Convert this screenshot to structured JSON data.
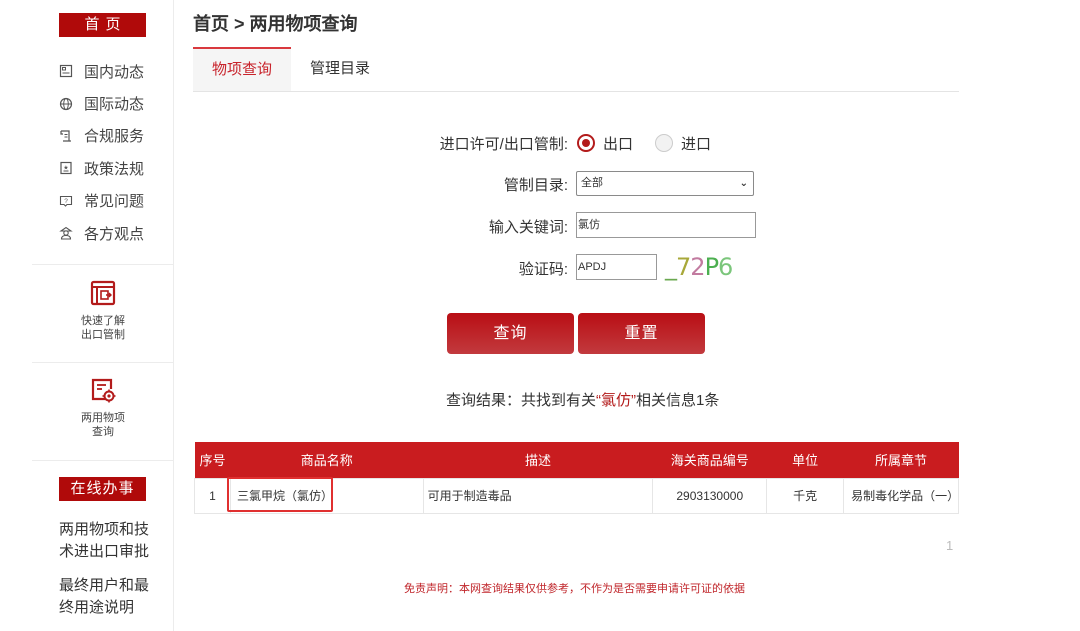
{
  "sidebar": {
    "home_label": "首页",
    "nav_items": [
      {
        "label": "国内动态",
        "icon": "document-icon"
      },
      {
        "label": "国际动态",
        "icon": "globe-icon"
      },
      {
        "label": "合规服务",
        "icon": "scroll-icon"
      },
      {
        "label": "政策法规",
        "icon": "badge-icon"
      },
      {
        "label": "常见问题",
        "icon": "question-icon"
      },
      {
        "label": "各方观点",
        "icon": "person-icon"
      }
    ],
    "tiles": [
      {
        "label": "快速了解出口管制",
        "icon": "export-doc-icon"
      },
      {
        "label": "两用物项查询",
        "icon": "item-search-icon"
      }
    ],
    "online_label": "在线办事",
    "online_links": [
      "两用物项和技术进出口审批",
      "最终用户和最终用途说明"
    ]
  },
  "header": {
    "breadcrumb": "首页 > 两用物项查询"
  },
  "tabs": [
    {
      "label": "物项查询",
      "active": true
    },
    {
      "label": "管理目录",
      "active": false
    }
  ],
  "form": {
    "direction_label": "进口许可/出口管制:",
    "direction_options": [
      {
        "label": "出口",
        "checked": true
      },
      {
        "label": "进口",
        "checked": false
      }
    ],
    "catalog_label": "管制目录:",
    "catalog_value": "全部",
    "keyword_label": "输入关键词:",
    "keyword_value": "氯仿",
    "captcha_label": "验证码:",
    "captcha_input_value": "APDJ",
    "captcha_image_text": "72P6",
    "search_button": "查询",
    "reset_button": "重置"
  },
  "results": {
    "summary_prefix": "查询结果：共找到有关",
    "summary_keyword": "“氯仿”",
    "summary_suffix": "相关信息1条",
    "columns": [
      "序号",
      "商品名称",
      "描述",
      "海关商品编号",
      "单位",
      "所属章节"
    ],
    "rows": [
      [
        "1",
        "三氯甲烷（氯仿）",
        "可用于制造毒品",
        "2903130000",
        "千克",
        "易制毒化学品（一）"
      ]
    ],
    "page_number": "1"
  },
  "disclaimer": "免责声明：本网查询结果仅供参考，不作为是否需要申请许可证的依据",
  "colors": {
    "brand_red": "#b00a0a",
    "table_header": "#c91c1f",
    "highlight_box": "#e03030"
  }
}
